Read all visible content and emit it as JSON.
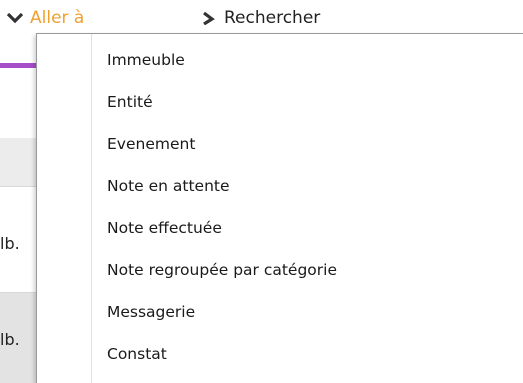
{
  "toolbar": {
    "goto_label": "Aller à",
    "search_label": "Rechercher",
    "goto_color": "#f0a030",
    "accent_color": "#a64ec8"
  },
  "background": {
    "row_labels": [
      "lb.",
      "lb."
    ]
  },
  "menu": {
    "items": [
      {
        "label": "Immeuble"
      },
      {
        "label": "Entité"
      },
      {
        "label": "Evenement"
      },
      {
        "label": "Note en attente"
      },
      {
        "label": "Note effectuée"
      },
      {
        "label": "Note regroupée par catégorie"
      },
      {
        "label": "Messagerie"
      },
      {
        "label": "Constat"
      }
    ]
  }
}
